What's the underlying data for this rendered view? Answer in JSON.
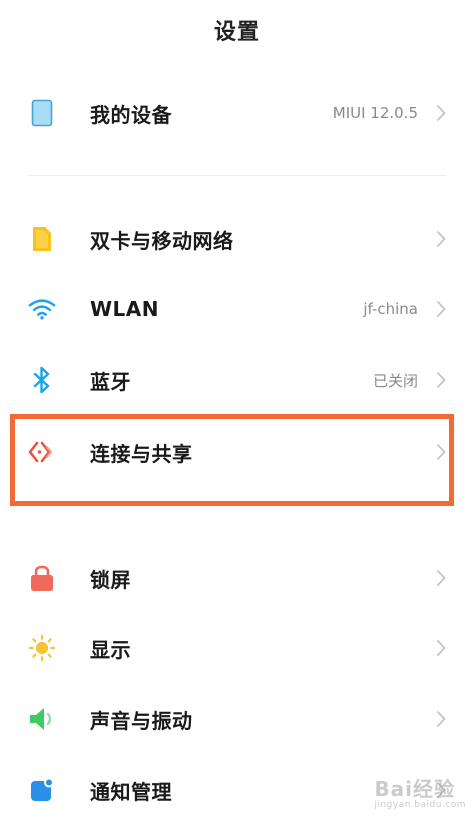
{
  "header": {
    "title": "设置"
  },
  "items": [
    {
      "label": "我的设备",
      "value": "MIUI 12.0.5",
      "icon": "device-icon"
    },
    {
      "label": "双卡与移动网络",
      "value": "",
      "icon": "sim-card-icon"
    },
    {
      "label": "WLAN",
      "value": "jf-china",
      "icon": "wifi-icon"
    },
    {
      "label": "蓝牙",
      "value": "已关闭",
      "icon": "bluetooth-icon"
    },
    {
      "label": "连接与共享",
      "value": "",
      "icon": "connection-share-icon"
    },
    {
      "label": "锁屏",
      "value": "",
      "icon": "lock-icon"
    },
    {
      "label": "显示",
      "value": "",
      "icon": "sun-icon"
    },
    {
      "label": "声音与振动",
      "value": "",
      "icon": "speaker-icon"
    },
    {
      "label": "通知管理",
      "value": "",
      "icon": "notification-icon"
    }
  ],
  "colors": {
    "highlight": "#f46a37",
    "device": "#9fd4f2",
    "sim": "#f7c21b",
    "wifi": "#1aa4e9",
    "bluetooth": "#1aa4e9",
    "connection": "#e8553e",
    "lock": "#ef6a5c",
    "sun": "#f6c431",
    "speaker": "#3ecb62",
    "notification": "#2a8fe8"
  },
  "watermark": {
    "brand": "Bai经验",
    "url": "jingyan.baidu.com"
  }
}
